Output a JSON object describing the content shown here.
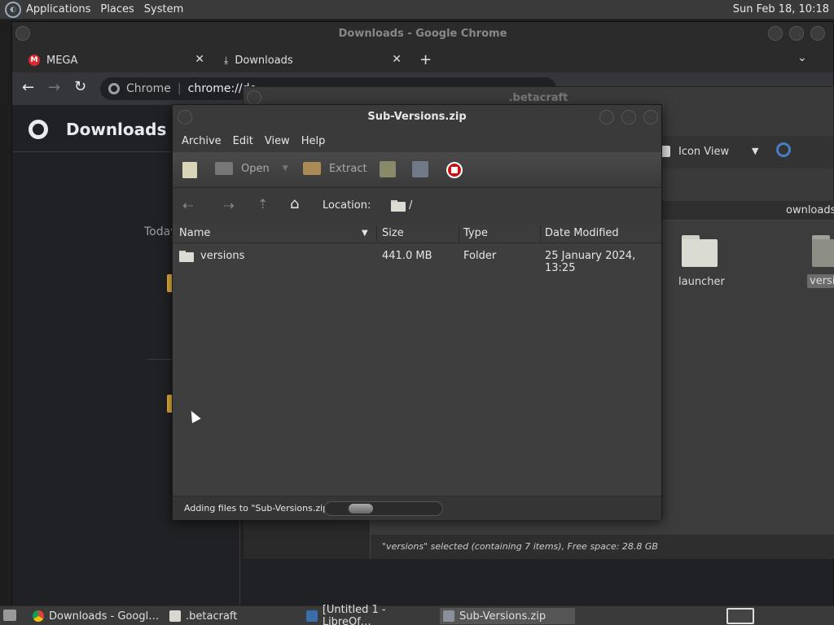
{
  "top_panel": {
    "menus": [
      "Applications",
      "Places",
      "System"
    ],
    "clock": "Sun Feb 18, 10:18"
  },
  "chrome": {
    "window_title": "Downloads - Google Chrome",
    "tabs": [
      {
        "label": "MEGA",
        "icon": "mega-icon"
      },
      {
        "label": "Downloads",
        "icon": "download-icon"
      }
    ],
    "omnibox_prefix": "Chrome",
    "omnibox_url": "chrome://do",
    "page_title": "Downloads",
    "section_label": "Today"
  },
  "betacraft": {
    "window_title": ".betacraft",
    "view_mode": "Icon View",
    "path_label": "ownloads",
    "items": [
      {
        "label": "launcher",
        "icon": "folder-icon"
      },
      {
        "label": "versio",
        "icon": "folder-icon",
        "selected": true
      }
    ],
    "status": "\"versions\" selected (containing 7 items), Free space: 28.8 GB"
  },
  "archive": {
    "window_title": "Sub-Versions.zip",
    "menus": [
      "Archive",
      "Edit",
      "View",
      "Help"
    ],
    "toolbar": {
      "open_label": "Open",
      "extract_label": "Extract"
    },
    "location_label": "Location:",
    "location_value": "/",
    "columns": [
      "Name",
      "Size",
      "Type",
      "Date Modified"
    ],
    "rows": [
      {
        "name": "versions",
        "size": "441.0 MB",
        "type": "Folder",
        "date": "25 January 2024, 13:25"
      }
    ],
    "status": "Adding files to \"Sub-Versions.zip\"",
    "progress": 0.2
  },
  "taskbar": {
    "items": [
      {
        "label": "Downloads - Googl…",
        "icon": "chrome-icon"
      },
      {
        "label": ".betacraft",
        "icon": "folder-icon"
      },
      {
        "label": "[Untitled 1 - LibreOf…",
        "icon": "writer-icon"
      },
      {
        "label": "Sub-Versions.zip",
        "icon": "archive-icon",
        "active": true
      }
    ]
  }
}
